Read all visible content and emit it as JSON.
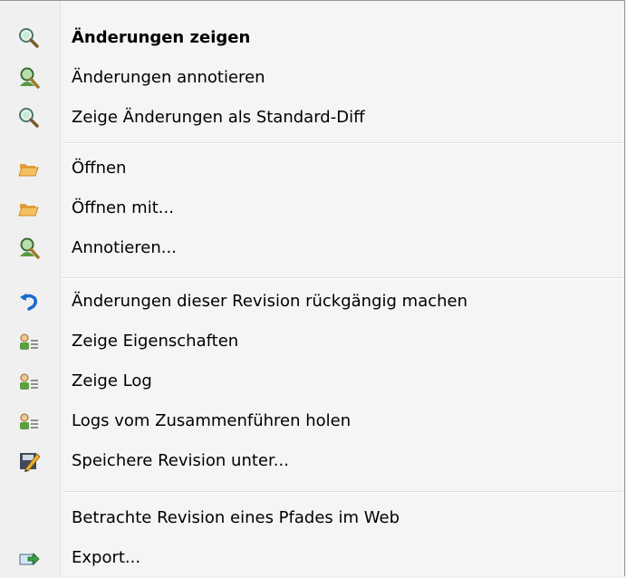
{
  "menu": {
    "items": [
      {
        "label": "Änderungen zeigen",
        "icon": "magnifier-icon",
        "bold": true
      },
      {
        "label": "Änderungen annotieren",
        "icon": "annotate-magnifier-person-icon"
      },
      {
        "label": "Zeige Änderungen als Standard-Diff",
        "icon": "magnifier-icon"
      },
      {
        "label": "Öffnen",
        "icon": "folder-open-icon"
      },
      {
        "label": "Öffnen mit...",
        "icon": "folder-open-icon"
      },
      {
        "label": "Annotieren...",
        "icon": "annotate-magnifier-person-icon"
      },
      {
        "label": "Änderungen dieser Revision rückgängig machen",
        "icon": "revert-arrow-icon"
      },
      {
        "label": "Zeige Eigenschaften",
        "icon": "user-list-icon"
      },
      {
        "label": "Zeige Log",
        "icon": "user-list-icon"
      },
      {
        "label": "Logs vom Zusammenführen holen",
        "icon": "user-list-icon"
      },
      {
        "label": "Speichere Revision unter...",
        "icon": "save-pencil-icon"
      },
      {
        "label": "Betrachte Revision eines Pfades im Web",
        "icon": ""
      },
      {
        "label": "Export...",
        "icon": "export-folder-arrow-icon"
      }
    ]
  },
  "colors": {
    "menu_bg": "#f5f5f5",
    "gutter_bg": "#f0f0f0",
    "separator": "#e0e0e0",
    "text": "#000000"
  }
}
